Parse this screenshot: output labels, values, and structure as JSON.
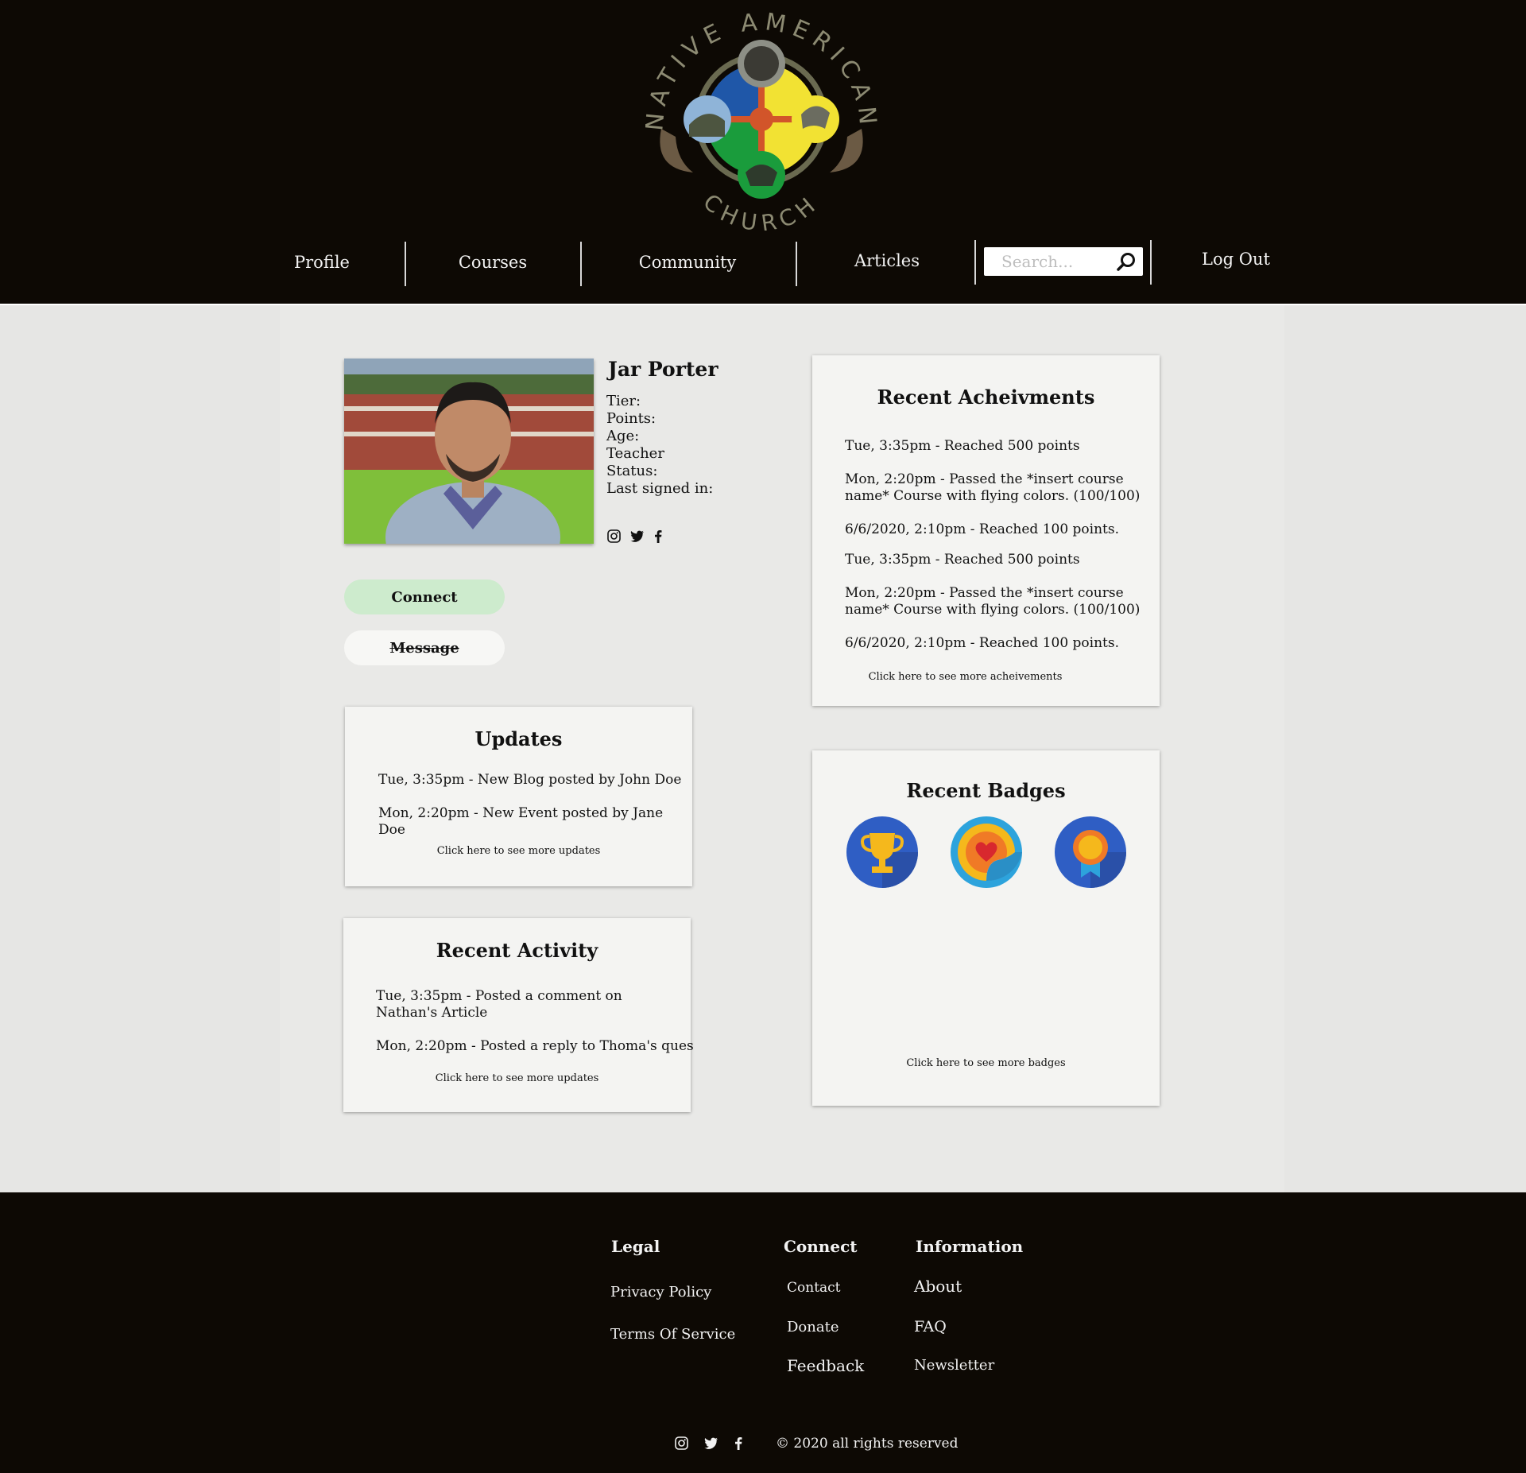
{
  "logo": {
    "text_top": "NATIVE AMERICAN",
    "text_bottom": "CHURCH"
  },
  "nav": {
    "profile": "Profile",
    "courses": "Courses",
    "community": "Community",
    "articles": "Articles",
    "search_placeholder": "Search...",
    "logout": "Log Out"
  },
  "profile": {
    "name": "Jar Porter",
    "tier_label": "Tier:",
    "points_label": "Points:",
    "age_label": "Age:",
    "role": "Teacher",
    "status_label": "Status:",
    "last_signed_label": "Last signed in:",
    "connect_label": "Connect",
    "message_label": "Message"
  },
  "updates": {
    "title": "Updates",
    "items": [
      "Tue, 3:35pm  - New Blog posted by John Doe",
      "Mon, 2:20pm - New Event posted by Jane Doe"
    ],
    "more": "Click here to see more updates"
  },
  "activity": {
    "title": "Recent Activity",
    "items": [
      "Tue, 3:35pm  - Posted a comment on Nathan's Article",
      "Mon, 2:20pm - Posted a reply to Thoma's ques"
    ],
    "more": "Click here to see more updates"
  },
  "achievements": {
    "title": "Recent Acheivments",
    "items": [
      "Tue, 3:35pm  - Reached 500 points",
      "Mon, 2:20pm - Passed the *insert course name* Course with flying colors. (100/100)",
      "6/6/2020, 2:10pm - Reached 100 points.",
      "Tue, 3:35pm  - Reached 500 points",
      "Mon, 2:20pm - Passed the *insert course name* Course with flying colors. (100/100)",
      "6/6/2020, 2:10pm - Reached 100 points."
    ],
    "more": "Click here to see more acheivements"
  },
  "badges": {
    "title": "Recent Badges",
    "icons": [
      "trophy-badge-icon",
      "heart-sticker-badge-icon",
      "ribbon-medal-badge-icon"
    ],
    "more": "Click here to see more badges"
  },
  "footer": {
    "legal": {
      "heading": "Legal",
      "links": [
        "Privacy Policy",
        "Terms Of Service"
      ]
    },
    "connect": {
      "heading": "Connect",
      "links": [
        "Contact",
        "Donate",
        "Feedback"
      ]
    },
    "information": {
      "heading": "Information",
      "links": [
        "About",
        "FAQ",
        "Newsletter"
      ]
    },
    "copyright": "© 2020 all rights reserved"
  },
  "colors": {
    "header_bg": "#0d0904",
    "page_bg": "#e6e6e4",
    "card_bg": "#f4f4f2",
    "connect_button": "#cdebcd",
    "badge_blue": "#2f5ec4"
  }
}
